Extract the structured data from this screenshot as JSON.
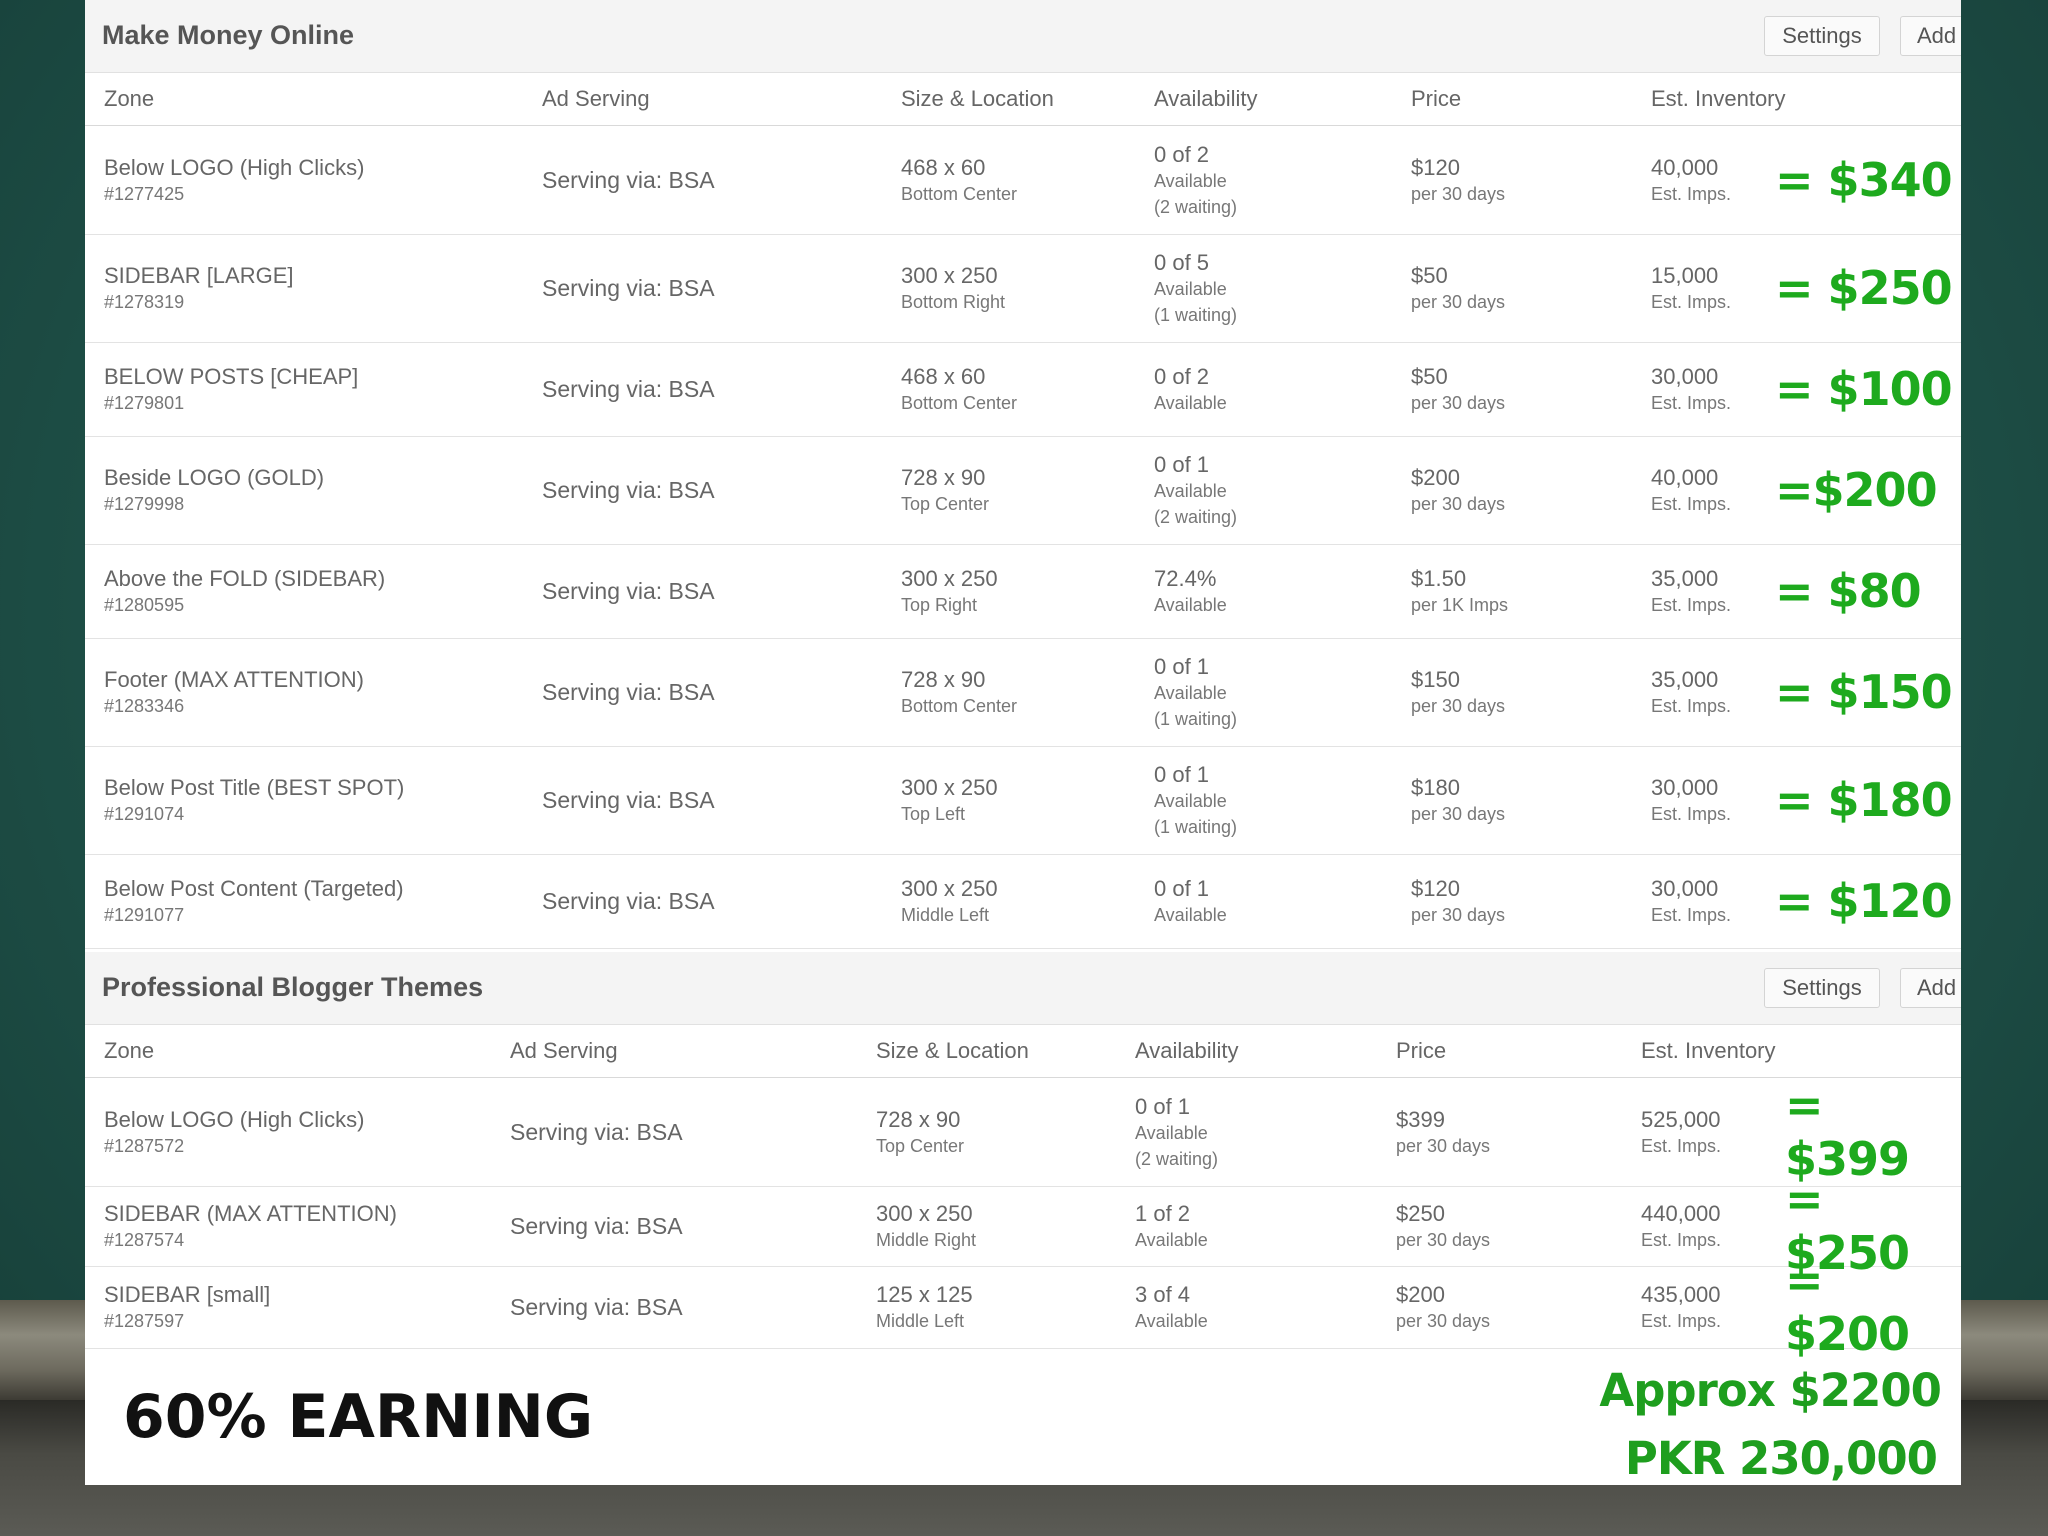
{
  "sections": [
    {
      "title": "Make Money Online",
      "settings_label": "Settings",
      "add_label": "Add",
      "columns": [
        "Zone",
        "Ad Serving",
        "Size & Location",
        "Availability",
        "Price",
        "Est. Inventory"
      ],
      "rows": [
        {
          "zone": "Below LOGO (High Clicks)",
          "id": "#1277425",
          "serving": "Serving via: BSA",
          "size": "468 x 60",
          "location": "Bottom Center",
          "avail": "0 of 2",
          "avail_sub": "Available",
          "waiting": "(2 waiting)",
          "price": "$120",
          "period": "per 30 days",
          "inventory": "40,000",
          "inv_unit": "Est. Imps.",
          "total": "= $340"
        },
        {
          "zone": "SIDEBAR [LARGE]",
          "id": "#1278319",
          "serving": "Serving via: BSA",
          "size": "300 x 250",
          "location": "Bottom Right",
          "avail": "0 of 5",
          "avail_sub": "Available",
          "waiting": "(1 waiting)",
          "price": "$50",
          "period": "per 30 days",
          "inventory": "15,000",
          "inv_unit": "Est. Imps.",
          "total": "= $250"
        },
        {
          "zone": "BELOW POSTS [CHEAP]",
          "id": "#1279801",
          "serving": "Serving via: BSA",
          "size": "468 x 60",
          "location": "Bottom Center",
          "avail": "0 of 2",
          "avail_sub": "Available",
          "waiting": "",
          "price": "$50",
          "period": "per 30 days",
          "inventory": "30,000",
          "inv_unit": "Est. Imps.",
          "total": "= $100"
        },
        {
          "zone": "Beside LOGO (GOLD)",
          "id": "#1279998",
          "serving": "Serving via: BSA",
          "size": "728 x 90",
          "location": "Top Center",
          "avail": "0 of 1",
          "avail_sub": "Available",
          "waiting": "(2 waiting)",
          "price": "$200",
          "period": "per 30 days",
          "inventory": "40,000",
          "inv_unit": "Est. Imps.",
          "total": "=$200"
        },
        {
          "zone": "Above the FOLD (SIDEBAR)",
          "id": "#1280595",
          "serving": "Serving via: BSA",
          "size": "300 x 250",
          "location": "Top Right",
          "avail": "72.4%",
          "avail_sub": "Available",
          "waiting": "",
          "price": "$1.50",
          "period": "per 1K Imps",
          "inventory": "35,000",
          "inv_unit": "Est. Imps.",
          "total": "= $80"
        },
        {
          "zone": "Footer (MAX ATTENTION)",
          "id": "#1283346",
          "serving": "Serving via: BSA",
          "size": "728 x 90",
          "location": "Bottom Center",
          "avail": "0 of 1",
          "avail_sub": "Available",
          "waiting": "(1 waiting)",
          "price": "$150",
          "period": "per 30 days",
          "inventory": "35,000",
          "inv_unit": "Est. Imps.",
          "total": "= $150"
        },
        {
          "zone": "Below Post Title (BEST SPOT)",
          "id": "#1291074",
          "serving": "Serving via: BSA",
          "size": "300 x 250",
          "location": "Top Left",
          "avail": "0 of 1",
          "avail_sub": "Available",
          "waiting": "(1 waiting)",
          "price": "$180",
          "period": "per 30 days",
          "inventory": "30,000",
          "inv_unit": "Est. Imps.",
          "total": "= $180"
        },
        {
          "zone": "Below Post Content (Targeted)",
          "id": "#1291077",
          "serving": "Serving via: BSA",
          "size": "300 x 250",
          "location": "Middle Left",
          "avail": "0 of 1",
          "avail_sub": "Available",
          "waiting": "",
          "price": "$120",
          "period": "per 30 days",
          "inventory": "30,000",
          "inv_unit": "Est. Imps.",
          "total": "= $120"
        }
      ]
    },
    {
      "title": "Professional Blogger Themes",
      "settings_label": "Settings",
      "add_label": "Add",
      "columns": [
        "Zone",
        "Ad Serving",
        "Size & Location",
        "Availability",
        "Price",
        "Est. Inventory"
      ],
      "rows": [
        {
          "zone": "Below LOGO (High Clicks)",
          "id": "#1287572",
          "serving": "Serving via: BSA",
          "size": "728 x 90",
          "location": "Top Center",
          "avail": "0 of 1",
          "avail_sub": "Available",
          "waiting": "(2 waiting)",
          "price": "$399",
          "period": "per 30 days",
          "inventory": "525,000",
          "inv_unit": "Est. Imps.",
          "total": "= $399"
        },
        {
          "zone": "SIDEBAR (MAX ATTENTION)",
          "id": "#1287574",
          "serving": "Serving via: BSA",
          "size": "300 x 250",
          "location": "Middle Right",
          "avail": "1 of 2",
          "avail_sub": "Available",
          "waiting": "",
          "price": "$250",
          "period": "per 30 days",
          "inventory": "440,000",
          "inv_unit": "Est. Imps.",
          "total": "= $250"
        },
        {
          "zone": "SIDEBAR [small]",
          "id": "#1287597",
          "serving": "Serving via: BSA",
          "size": "125 x 125",
          "location": "Middle Left",
          "avail": "3 of 4",
          "avail_sub": "Available",
          "waiting": "",
          "price": "$200",
          "period": "per 30 days",
          "inventory": "435,000",
          "inv_unit": "Est. Imps.",
          "total": "= $200"
        }
      ]
    }
  ],
  "footer": {
    "earning": "60% EARNING",
    "approx": "Approx $2200",
    "pkr": "PKR 230,000"
  },
  "colors": {
    "accent_green": "#1eaa1e",
    "board_green": "#1f5249"
  }
}
